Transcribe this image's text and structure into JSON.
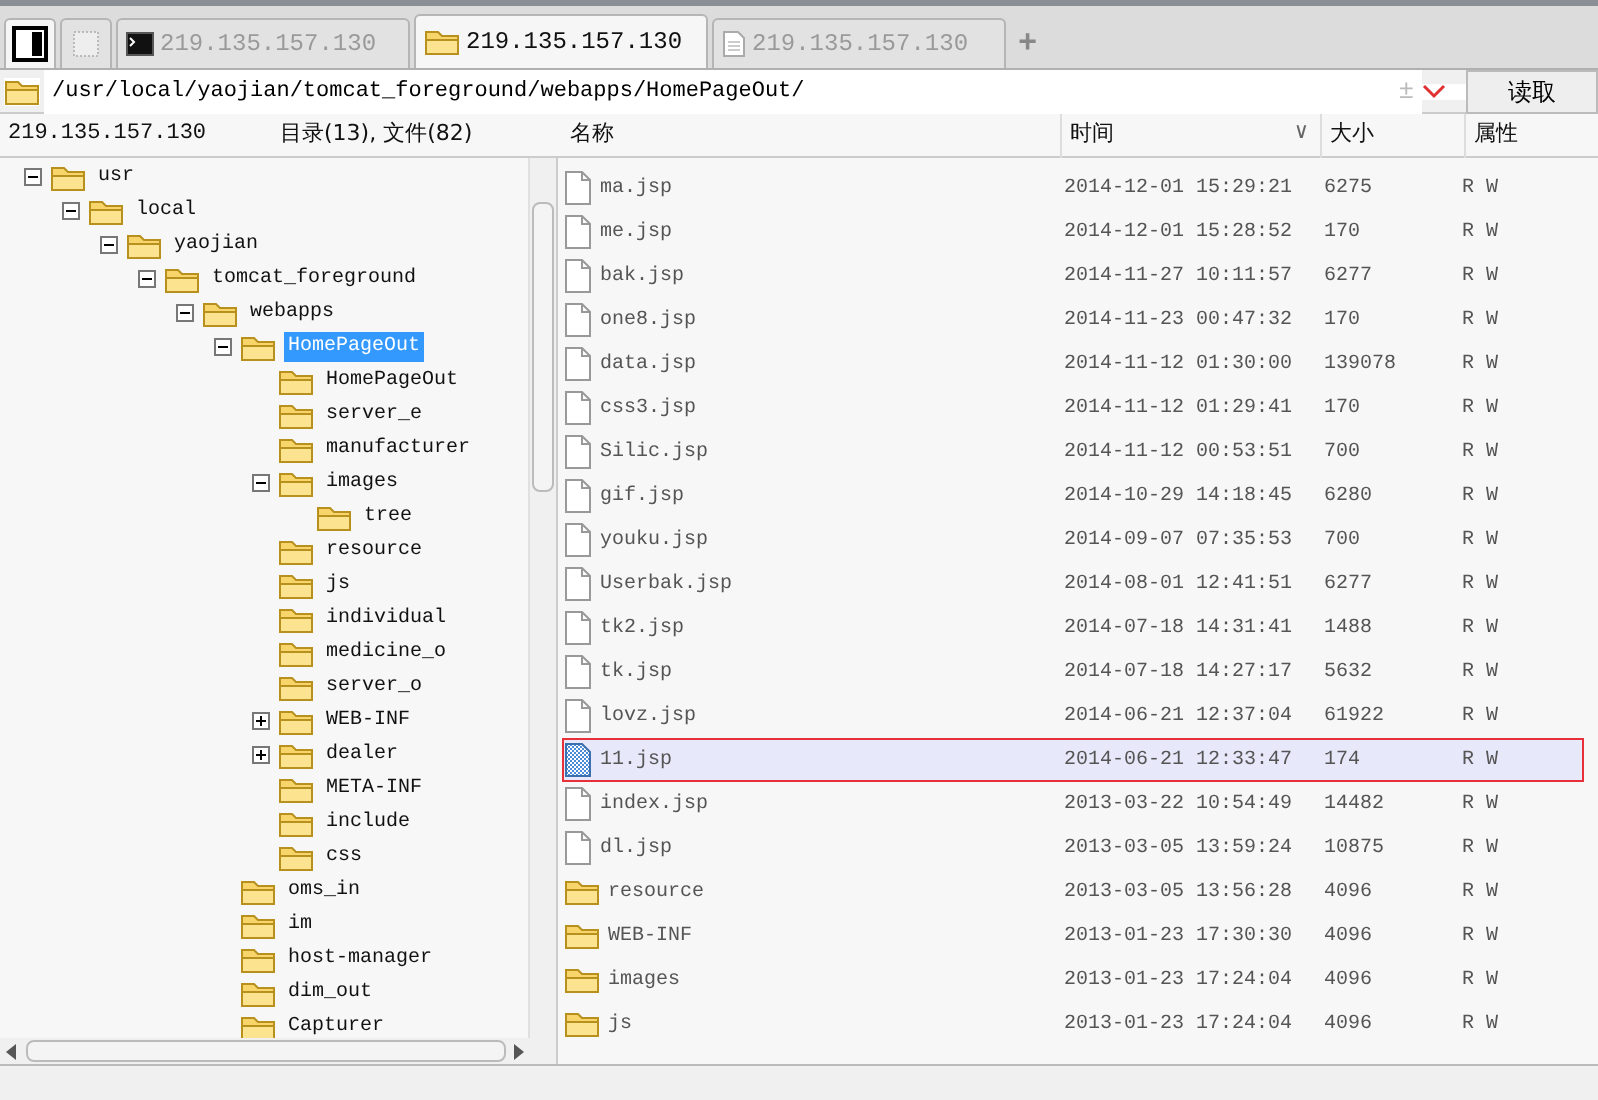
{
  "tabs": [
    {
      "kind": "panel",
      "selected": false
    },
    {
      "kind": "blank",
      "selected": false
    },
    {
      "kind": "terminal",
      "label": "219.135.157.130",
      "selected": false
    },
    {
      "kind": "folder",
      "label": "219.135.157.130",
      "selected": true
    },
    {
      "kind": "document",
      "label": "219.135.157.130",
      "selected": false
    }
  ],
  "new_tab": "+",
  "address_bar": {
    "value": "/usr/local/yaojian/tomcat_foreground/webapps/HomePageOut/",
    "plusminus": "±",
    "read_button": "读取"
  },
  "tree_header": {
    "host": "219.135.157.130",
    "counts": "目录(13), 文件(82)"
  },
  "tree": [
    {
      "name": "usr",
      "expanded": true,
      "selected": false,
      "children": [
        {
          "name": "local",
          "expanded": true,
          "selected": false,
          "children": [
            {
              "name": "yaojian",
              "expanded": true,
              "selected": false,
              "children": [
                {
                  "name": "tomcat_foreground",
                  "expanded": true,
                  "selected": false,
                  "children": [
                    {
                      "name": "webapps",
                      "expanded": true,
                      "selected": false,
                      "children": [
                        {
                          "name": "HomePageOut",
                          "expanded": true,
                          "selected": true,
                          "children": [
                            {
                              "name": "HomePageOut",
                              "selected": false
                            },
                            {
                              "name": "server_e",
                              "selected": false
                            },
                            {
                              "name": "manufacturer",
                              "selected": false
                            },
                            {
                              "name": "images",
                              "expanded": true,
                              "selected": false,
                              "children": [
                                {
                                  "name": "tree",
                                  "selected": false
                                }
                              ]
                            },
                            {
                              "name": "resource",
                              "selected": false
                            },
                            {
                              "name": "js",
                              "selected": false
                            },
                            {
                              "name": "individual",
                              "selected": false
                            },
                            {
                              "name": "medicine_o",
                              "selected": false
                            },
                            {
                              "name": "server_o",
                              "selected": false
                            },
                            {
                              "name": "WEB-INF",
                              "expanded": false,
                              "selected": false
                            },
                            {
                              "name": "dealer",
                              "expanded": false,
                              "selected": false
                            },
                            {
                              "name": "META-INF",
                              "selected": false
                            },
                            {
                              "name": "include",
                              "selected": false
                            },
                            {
                              "name": "css",
                              "selected": false
                            }
                          ]
                        },
                        {
                          "name": "oms_in",
                          "selected": false
                        },
                        {
                          "name": "im",
                          "selected": false
                        },
                        {
                          "name": "host-manager",
                          "selected": false
                        },
                        {
                          "name": "dim_out",
                          "selected": false
                        },
                        {
                          "name": "Capturer",
                          "selected": false
                        }
                      ]
                    }
                  ]
                }
              ]
            }
          ]
        }
      ]
    }
  ],
  "file_table": {
    "columns": [
      "名称",
      "时间",
      "大小",
      "属性"
    ],
    "sort_indicator": "∨",
    "rows": [
      {
        "kind": "file",
        "name": "ma.jsp",
        "time": "2014-12-01 15:29:21",
        "size": "6275",
        "attr": "R W",
        "selected": false
      },
      {
        "kind": "file",
        "name": "me.jsp",
        "time": "2014-12-01 15:28:52",
        "size": "170",
        "attr": "R W",
        "selected": false
      },
      {
        "kind": "file",
        "name": "bak.jsp",
        "time": "2014-11-27 10:11:57",
        "size": "6277",
        "attr": "R W",
        "selected": false
      },
      {
        "kind": "file",
        "name": "one8.jsp",
        "time": "2014-11-23 00:47:32",
        "size": "170",
        "attr": "R W",
        "selected": false
      },
      {
        "kind": "file",
        "name": "data.jsp",
        "time": "2014-11-12 01:30:00",
        "size": "139078",
        "attr": "R W",
        "selected": false
      },
      {
        "kind": "file",
        "name": "css3.jsp",
        "time": "2014-11-12 01:29:41",
        "size": "170",
        "attr": "R W",
        "selected": false
      },
      {
        "kind": "file",
        "name": "Silic.jsp",
        "time": "2014-11-12 00:53:51",
        "size": "700",
        "attr": "R W",
        "selected": false
      },
      {
        "kind": "file",
        "name": "gif.jsp",
        "time": "2014-10-29 14:18:45",
        "size": "6280",
        "attr": "R W",
        "selected": false
      },
      {
        "kind": "file",
        "name": "youku.jsp",
        "time": "2014-09-07 07:35:53",
        "size": "700",
        "attr": "R W",
        "selected": false
      },
      {
        "kind": "file",
        "name": "Userbak.jsp",
        "time": "2014-08-01 12:41:51",
        "size": "6277",
        "attr": "R W",
        "selected": false
      },
      {
        "kind": "file",
        "name": "tk2.jsp",
        "time": "2014-07-18 14:31:41",
        "size": "1488",
        "attr": "R W",
        "selected": false
      },
      {
        "kind": "file",
        "name": "tk.jsp",
        "time": "2014-07-18 14:27:17",
        "size": "5632",
        "attr": "R W",
        "selected": false
      },
      {
        "kind": "file",
        "name": "lovz.jsp",
        "time": "2014-06-21 12:37:04",
        "size": "61922",
        "attr": "R W",
        "selected": false
      },
      {
        "kind": "file",
        "name": "11.jsp",
        "time": "2014-06-21 12:33:47",
        "size": "174",
        "attr": "R W",
        "selected": true
      },
      {
        "kind": "file",
        "name": "index.jsp",
        "time": "2013-03-22 10:54:49",
        "size": "14482",
        "attr": "R W",
        "selected": false
      },
      {
        "kind": "file",
        "name": "dl.jsp",
        "time": "2013-03-05 13:59:24",
        "size": "10875",
        "attr": "R W",
        "selected": false
      },
      {
        "kind": "folder",
        "name": "resource",
        "time": "2013-03-05 13:56:28",
        "size": "4096",
        "attr": "R W",
        "selected": false
      },
      {
        "kind": "folder",
        "name": "WEB-INF",
        "time": "2013-01-23 17:30:30",
        "size": "4096",
        "attr": "R W",
        "selected": false
      },
      {
        "kind": "folder",
        "name": "images",
        "time": "2013-01-23 17:24:04",
        "size": "4096",
        "attr": "R W",
        "selected": false
      },
      {
        "kind": "folder",
        "name": "js",
        "time": "2013-01-23 17:24:04",
        "size": "4096",
        "attr": "R W",
        "selected": false
      }
    ]
  }
}
